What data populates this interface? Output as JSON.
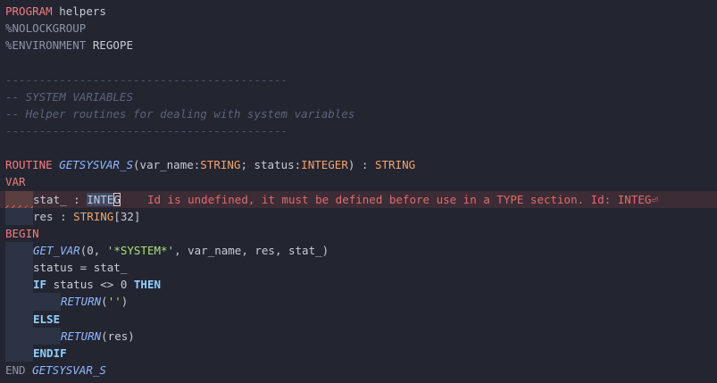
{
  "editor": {
    "lines": {
      "l1": {
        "kw": "PROGRAM",
        "name": " helpers"
      },
      "l2": {
        "text": "%NOLOCKGROUP"
      },
      "l3": {
        "text": "%ENVIRONMENT",
        "name": " REGOPE"
      },
      "l4": {
        "text": ""
      },
      "l5": {
        "text": "------------------------------------------"
      },
      "l6": {
        "text": "-- SYSTEM VARIABLES"
      },
      "l7": {
        "text": "-- Helper routines for dealing with system variables"
      },
      "l8": {
        "text": "------------------------------------------"
      },
      "l9": {
        "text": ""
      },
      "l10": {
        "kw": "ROUTINE",
        "fn": "GETSYSVAR_S",
        "p1": "(var_name:",
        "t1": "STRING",
        "p2": "; status:",
        "t2": "INTEGER",
        "p3": ") : ",
        "t3": "STRING"
      },
      "l11": {
        "kw": "VAR"
      },
      "l12": {
        "pre": "stat_ : ",
        "sel": "INTE",
        "caret": "G",
        "error": "    Id is undefined, it must be defined before use in a TYPE section. Id: INTEG⏎"
      },
      "l13": {
        "pre": "res : ",
        "t1": "STRING",
        "p1": "[32]"
      },
      "l14": {
        "kw": "BEGIN"
      },
      "l15": {
        "fn": "GET_VAR",
        "p1": "(0, ",
        "s1": "'*SYSTEM*'",
        "p2": ", var_name, res, stat_)"
      },
      "l16": {
        "text": "status = stat_"
      },
      "l17": {
        "kw": "IF",
        "p1": " status <> 0 ",
        "kw2": "THEN"
      },
      "l18": {
        "fn": "RETURN",
        "p1": "(",
        "s1": "''",
        "p2": ")"
      },
      "l19": {
        "kw": "ELSE"
      },
      "l20": {
        "fn": "RETURN",
        "p1": "(res)"
      },
      "l21": {
        "kw": "ENDIF"
      },
      "l22": {
        "kw": "END",
        "fn": " GETSYSVAR_S"
      }
    }
  }
}
